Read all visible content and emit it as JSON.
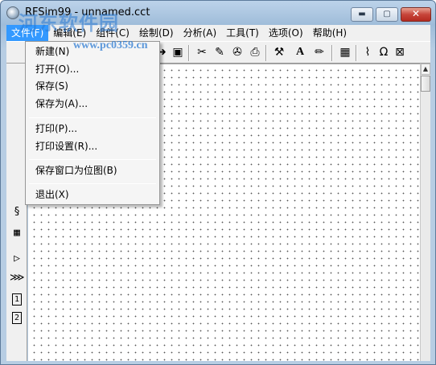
{
  "window": {
    "title": "RFSim99 - unnamed.cct",
    "watermark": "河东软件园",
    "watermark_url": "www.pc0359.cn",
    "minimize_glyph": "▬",
    "maximize_glyph": "▢",
    "close_glyph": "✕"
  },
  "menubar": {
    "items": [
      {
        "label": "文件(F)",
        "active": true
      },
      {
        "label": "编辑(E)"
      },
      {
        "label": "组件(C)"
      },
      {
        "label": "绘制(D)"
      },
      {
        "label": "分析(A)"
      },
      {
        "label": "工具(T)"
      },
      {
        "label": "选项(O)"
      },
      {
        "label": "帮助(H)"
      }
    ]
  },
  "file_menu": {
    "items": [
      "新建(N)",
      "打开(O)...",
      "保存(S)",
      "保存为(A)...",
      "打印(P)...",
      "打印设置(R)...",
      "保存窗口为位图(B)",
      "退出(X)"
    ]
  },
  "toolbar": {
    "icons": [
      "arrow-icon",
      "save-icon",
      "component-a-icon",
      "component-b-icon",
      "component-c-icon",
      "printer-icon",
      "wand-icon",
      "text-a-icon",
      "pencil-icon",
      "calculator-icon",
      "probe-icon",
      "omega-icon",
      "smith-chart-icon"
    ],
    "glyphs": [
      "➜",
      "▣",
      "✂",
      "✎",
      "✇",
      "⎙",
      "⚒",
      "A",
      "✏",
      "▦",
      "⌇",
      "Ω",
      "⊠"
    ]
  },
  "palette": {
    "icons": [
      "inductor-icon",
      "capacitor-stack-icon",
      "amplifier-icon",
      "transformer-icon",
      "port-1-icon",
      "port-2-icon"
    ],
    "glyphs": [
      "§",
      "▦",
      "▷",
      "⋙",
      "1",
      "2"
    ]
  }
}
